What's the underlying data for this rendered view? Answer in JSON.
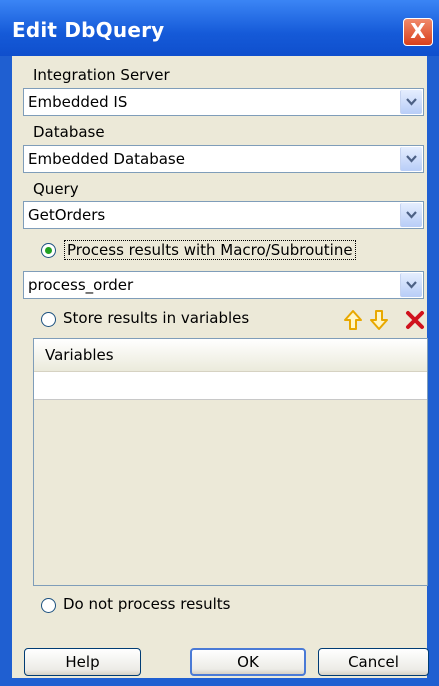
{
  "window": {
    "title": "Edit DbQuery",
    "close_label": "X"
  },
  "integration_server": {
    "label": "Integration Server",
    "value": "Embedded IS"
  },
  "database": {
    "label": "Database",
    "value": "Embedded Database"
  },
  "query": {
    "label": "Query",
    "value": "GetOrders"
  },
  "options": {
    "process_macro_label": "Process results with Macro/Subroutine",
    "macro_value": "process_order",
    "store_variables_label": "Store results in variables",
    "do_not_process_label": "Do not process results",
    "selected": "process_macro"
  },
  "variables_table": {
    "header": "Variables",
    "rows": [
      ""
    ]
  },
  "buttons": {
    "help": "Help",
    "ok": "OK",
    "cancel": "Cancel"
  },
  "icons": {
    "move_up": "arrow-up-icon",
    "move_down": "arrow-down-icon",
    "delete": "delete-x-icon"
  },
  "colors": {
    "titlebar": "#155ad8",
    "client": "#ece9d8",
    "selected_radio": "#21a121",
    "arrow_icon": "#e8a800",
    "delete_icon": "#d0121d"
  }
}
